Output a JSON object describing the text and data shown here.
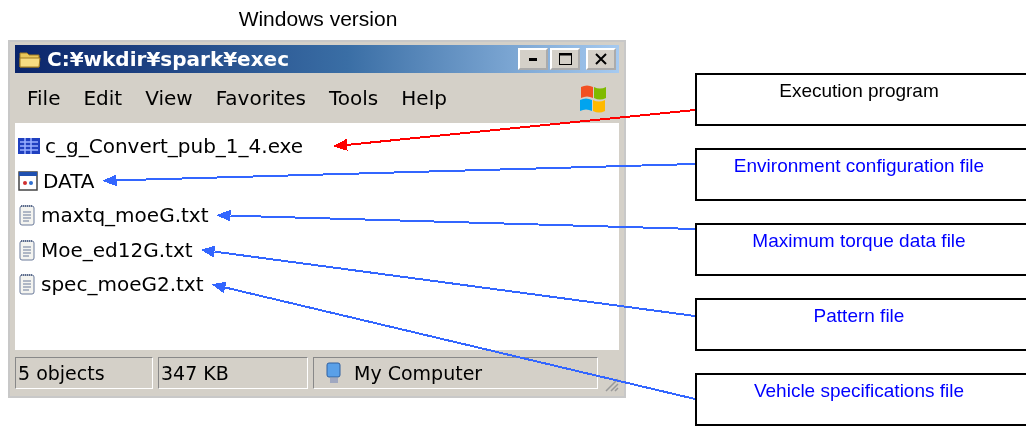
{
  "heading": "Windows version",
  "window": {
    "title": "C:¥wkdir¥spark¥exec",
    "menu": [
      "File",
      "Edit",
      "View",
      "Favorites",
      "Tools",
      "Help"
    ],
    "files": [
      {
        "name": "c_g_Convert_pub_1_4.exe",
        "kind": "exe"
      },
      {
        "name": "DATA",
        "kind": "config"
      },
      {
        "name": "maxtq_moeG.txt",
        "kind": "text"
      },
      {
        "name": "Moe_ed12G.txt",
        "kind": "text"
      },
      {
        "name": "spec_moeG2.txt",
        "kind": "text"
      }
    ],
    "status_bar": {
      "objects": "5 objects",
      "size": "347 KB",
      "location": "My Computer"
    }
  },
  "callouts": [
    {
      "label": "Execution program",
      "kind": "program",
      "color": "#ff0000"
    },
    {
      "label": "Environment configuration file",
      "kind": "file",
      "color": "#3366ff"
    },
    {
      "label": "Maximum torque data file",
      "kind": "file",
      "color": "#3366ff"
    },
    {
      "label": "Pattern file",
      "kind": "file",
      "color": "#3366ff"
    },
    {
      "label": "Vehicle specifications file",
      "kind": "file",
      "color": "#3366ff"
    }
  ]
}
